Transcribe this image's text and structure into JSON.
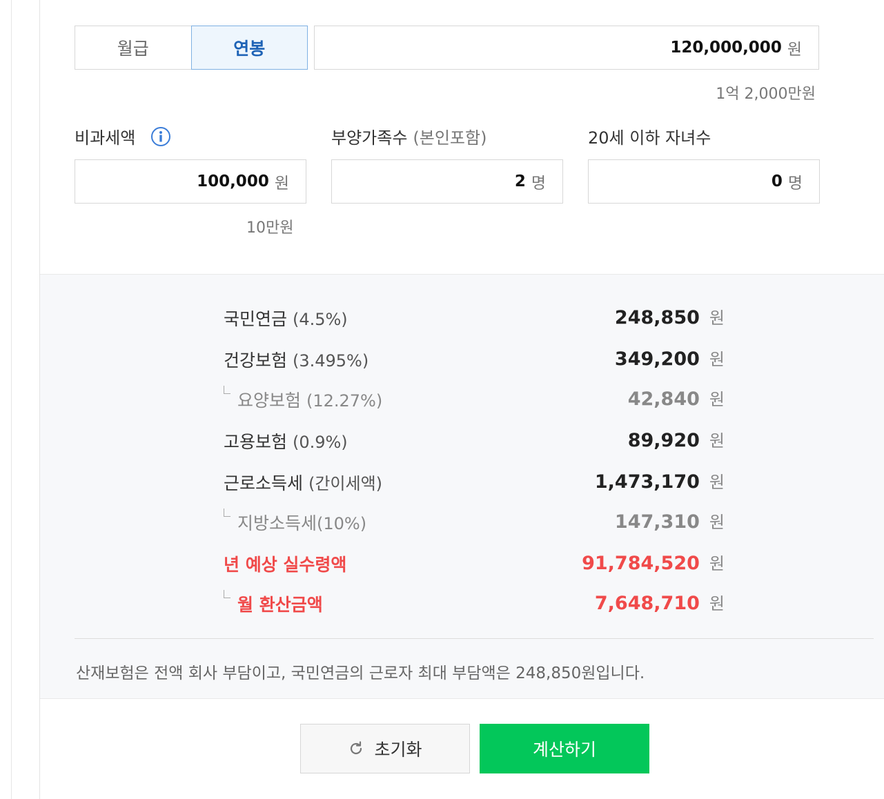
{
  "salary_type": {
    "tabs": [
      "월급",
      "연봉"
    ],
    "selected": "연봉"
  },
  "salary_input": {
    "value": "120,000,000",
    "unit": "원",
    "korean": "1억 2,000만원"
  },
  "nontax": {
    "label": "비과세액",
    "value": "100,000",
    "unit": "원",
    "korean": "10만원",
    "icon": "info-icon"
  },
  "dependents": {
    "label": "부양가족수",
    "sub": "(본인포함)",
    "value": "2",
    "unit": "명"
  },
  "children": {
    "label": "20세 이하 자녀수",
    "value": "0",
    "unit": "명"
  },
  "results": [
    {
      "label": "국민연금",
      "pct": "(4.5%)",
      "value": "248,850",
      "unit": "원"
    },
    {
      "label": "건강보험",
      "pct": "(3.495%)",
      "value": "349,200",
      "unit": "원"
    },
    {
      "label": "요양보험",
      "pct": "(12.27%)",
      "value": "42,840",
      "unit": "원"
    },
    {
      "label": "고용보험",
      "pct": "(0.9%)",
      "value": "89,920",
      "unit": "원"
    },
    {
      "label": "근로소득세",
      "pct": "(간이세액)",
      "value": "1,473,170",
      "unit": "원"
    },
    {
      "label": "지방소득세",
      "pct": "(10%)",
      "value": "147,310",
      "unit": "원"
    },
    {
      "label": "년 예상 실수령액",
      "pct": "",
      "value": "91,784,520",
      "unit": "원"
    },
    {
      "label": "월 환산금액",
      "pct": "",
      "value": "7,648,710",
      "unit": "원"
    }
  ],
  "note": "산재보험은 전액 회사 부담이고, 국민연금의 근로자 최대 부담액은 248,850원입니다.",
  "buttons": {
    "reset": "초기화",
    "calculate": "계산하기"
  },
  "colors": {
    "accent_blue": "#1e63b6",
    "highlight_red": "#f04a4a",
    "calc_green": "#03c75a"
  }
}
